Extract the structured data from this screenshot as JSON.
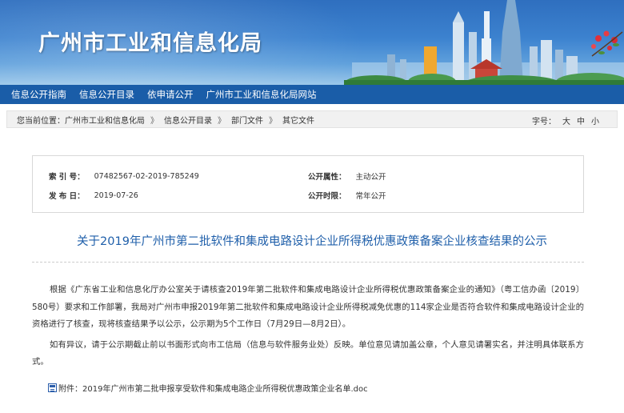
{
  "header": {
    "site_title": "广州市工业和信息化局"
  },
  "nav": {
    "items": [
      {
        "label": "信息公开指南"
      },
      {
        "label": "信息公开目录"
      },
      {
        "label": "依申请公开"
      },
      {
        "label": "广州市工业和信息化局网站"
      }
    ]
  },
  "breadcrumb": {
    "prefix": "您当前位置：",
    "items": [
      {
        "label": "广州市工业和信息化局"
      },
      {
        "label": "信息公开目录"
      },
      {
        "label": "部门文件"
      },
      {
        "label": "其它文件"
      }
    ],
    "separator": "》",
    "font_size_label": "字号：",
    "font_sizes": [
      "大",
      "中",
      "小"
    ]
  },
  "meta": {
    "index_label": "索 引 号：",
    "index_value": "07482567-02-2019-785249",
    "date_label": "发 布 日：",
    "date_value": "2019-07-26",
    "attr_label": "公开属性：",
    "attr_value": "主动公开",
    "period_label": "公开时限：",
    "period_value": "常年公开"
  },
  "article": {
    "title": "关于2019年广州市第二批软件和集成电路设计企业所得税优惠政策备案企业核查结果的公示",
    "paragraphs": [
      "根据《广东省工业和信息化厅办公室关于请核查2019年第二批软件和集成电路设计企业所得税优惠政策备案企业的通知》（粤工信办函〔2019〕580号）要求和工作部署，我局对广州市申报2019年第二批软件和集成电路设计企业所得税减免优惠的114家企业是否符合软件和集成电路设计企业的资格进行了核查，现将核查结果予以公示，公示期为5个工作日（7月29日—8月2日）。",
      "如有异议，请于公示期截止前以书面形式向市工信局（信息与软件服务业处）反映。单位意见请加盖公章，个人意见请署实名，并注明具体联系方式。"
    ],
    "attachment": "附件：2019年广州市第二批申报享受软件和集成电路企业所得税优惠政策企业名单.doc"
  }
}
